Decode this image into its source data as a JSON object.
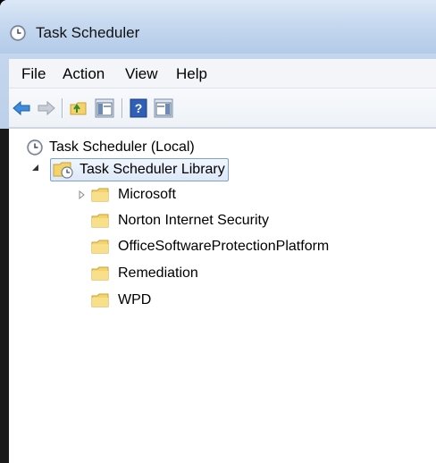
{
  "window": {
    "title": "Task Scheduler",
    "title_icon": "clock-icon"
  },
  "menu": {
    "items": [
      {
        "label": "File"
      },
      {
        "label": "Action"
      },
      {
        "label": "View"
      },
      {
        "label": "Help"
      }
    ]
  },
  "toolbar": {
    "buttons": [
      {
        "icon": "back-arrow-icon"
      },
      {
        "icon": "forward-arrow-icon"
      },
      {
        "icon": "up-folder-icon"
      },
      {
        "icon": "show-hide-console-tree-icon"
      },
      {
        "icon": "help-icon"
      },
      {
        "icon": "show-hide-action-pane-icon"
      }
    ]
  },
  "tree": {
    "root": {
      "label": "Task Scheduler (Local)",
      "icon": "clock-icon"
    },
    "library": {
      "label": "Task Scheduler Library",
      "icon": "clock-folder-icon",
      "expanded": true,
      "selected": true
    },
    "folders": [
      {
        "label": "Microsoft",
        "expandable": true
      },
      {
        "label": "Norton Internet Security"
      },
      {
        "label": "OfficeSoftwareProtectionPlatform"
      },
      {
        "label": "Remediation"
      },
      {
        "label": "WPD"
      }
    ]
  },
  "colors": {
    "title_bar": "#c5d8ef",
    "menu_bar": "#f3f5f8",
    "toolbar": "#eef2f7",
    "selection_border": "#7da2ce",
    "folder_yellow": "#f4d46a",
    "arrow_blue": "#3c8de0"
  }
}
